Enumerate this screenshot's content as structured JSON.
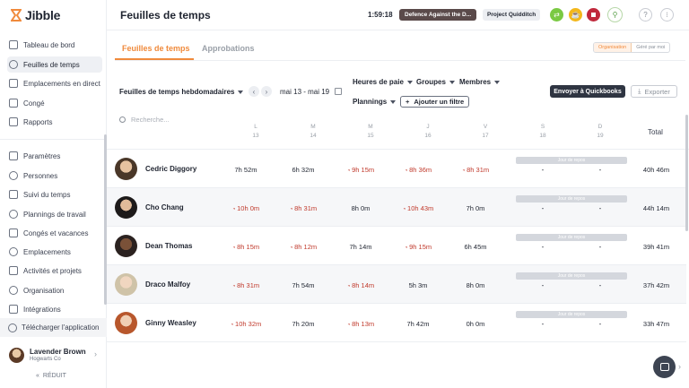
{
  "app": {
    "name": "Jibble"
  },
  "sidebar": {
    "items_top": [
      {
        "label": "Tableau de bord",
        "icon": "dashboard-icon"
      },
      {
        "label": "Feuilles de temps",
        "icon": "clock-icon",
        "active": true
      },
      {
        "label": "Emplacements en direct",
        "icon": "location-icon"
      },
      {
        "label": "Congé",
        "icon": "leave-icon"
      },
      {
        "label": "Rapports",
        "icon": "reports-icon"
      }
    ],
    "items_settings": [
      {
        "label": "Paramètres",
        "icon": "chevron-up-icon"
      },
      {
        "label": "Personnes",
        "icon": "people-icon"
      },
      {
        "label": "Suivi du temps",
        "icon": "time-tracking-icon"
      },
      {
        "label": "Plannings de travail",
        "icon": "schedule-icon"
      },
      {
        "label": "Congés et vacances",
        "icon": "holidays-icon"
      },
      {
        "label": "Emplacements",
        "icon": "pin-icon"
      },
      {
        "label": "Activités et projets",
        "icon": "tag-icon"
      },
      {
        "label": "Organisation",
        "icon": "gear-icon"
      },
      {
        "label": "Intégrations",
        "icon": "integrations-icon"
      }
    ],
    "download_label": "Télécharger l'application",
    "user": {
      "name": "Lavender Brown",
      "org": "Hogwarts Co"
    },
    "reduce_label": "RÉDUIT"
  },
  "topbar": {
    "title": "Feuilles de temps",
    "timer": "1:59:18",
    "activity": "Defence Against the D...",
    "project": "Project Quidditch"
  },
  "tabs": [
    {
      "label": "Feuilles de temps",
      "active": true
    },
    {
      "label": "Approbations",
      "active": false
    }
  ],
  "view_toggle": {
    "org": "Organisation",
    "managed": "Géré par moi"
  },
  "filters": {
    "period": "Feuilles de temps hebdomadaires",
    "date_range": "mai 13 - mai 19",
    "payroll_hours": "Heures de paie",
    "groups": "Groupes",
    "members": "Membres",
    "schedules": "Plannings",
    "add_filter": "Ajouter un filtre",
    "quickbooks": "Envoyer à Quickbooks",
    "export": "Exporter"
  },
  "table": {
    "search_placeholder": "Recherche...",
    "days": [
      {
        "letter": "L",
        "num": "13"
      },
      {
        "letter": "M",
        "num": "14"
      },
      {
        "letter": "M",
        "num": "15"
      },
      {
        "letter": "J",
        "num": "16"
      },
      {
        "letter": "V",
        "num": "17"
      },
      {
        "letter": "S",
        "num": "18"
      },
      {
        "letter": "D",
        "num": "19"
      }
    ],
    "total_header": "Total",
    "rest_label": "Jour de repos",
    "dash": "-",
    "rows": [
      {
        "name": "Cedric Diggory",
        "cells": [
          "7h 52m",
          "6h 32m",
          "9h 15m",
          "8h 36m",
          "8h 31m"
        ],
        "ot": [
          false,
          false,
          true,
          true,
          true
        ],
        "total": "40h 46m"
      },
      {
        "name": "Cho Chang",
        "cells": [
          "10h 0m",
          "8h 31m",
          "8h 0m",
          "10h 43m",
          "7h 0m"
        ],
        "ot": [
          true,
          true,
          false,
          true,
          false
        ],
        "total": "44h 14m"
      },
      {
        "name": "Dean Thomas",
        "cells": [
          "8h 15m",
          "8h 12m",
          "7h 14m",
          "9h 15m",
          "6h 45m"
        ],
        "ot": [
          true,
          true,
          false,
          true,
          false
        ],
        "total": "39h 41m"
      },
      {
        "name": "Draco Malfoy",
        "cells": [
          "8h 31m",
          "7h 54m",
          "8h 14m",
          "5h 3m",
          "8h 0m"
        ],
        "ot": [
          true,
          false,
          true,
          false,
          false
        ],
        "total": "37h 42m"
      },
      {
        "name": "Ginny Weasley",
        "cells": [
          "10h 32m",
          "7h 20m",
          "8h 13m",
          "7h 42m",
          "0h 0m"
        ],
        "ot": [
          true,
          false,
          true,
          false,
          false
        ],
        "total": "33h 47m"
      }
    ]
  },
  "colors": {
    "accent": "#f08a3c",
    "overtime": "#c0392b",
    "dark_button": "#2f3542",
    "activity_pill": "#5a4a4a",
    "timer_green": "#7ac943",
    "timer_yellow": "#f3b71b",
    "timer_red": "#c0283c"
  }
}
